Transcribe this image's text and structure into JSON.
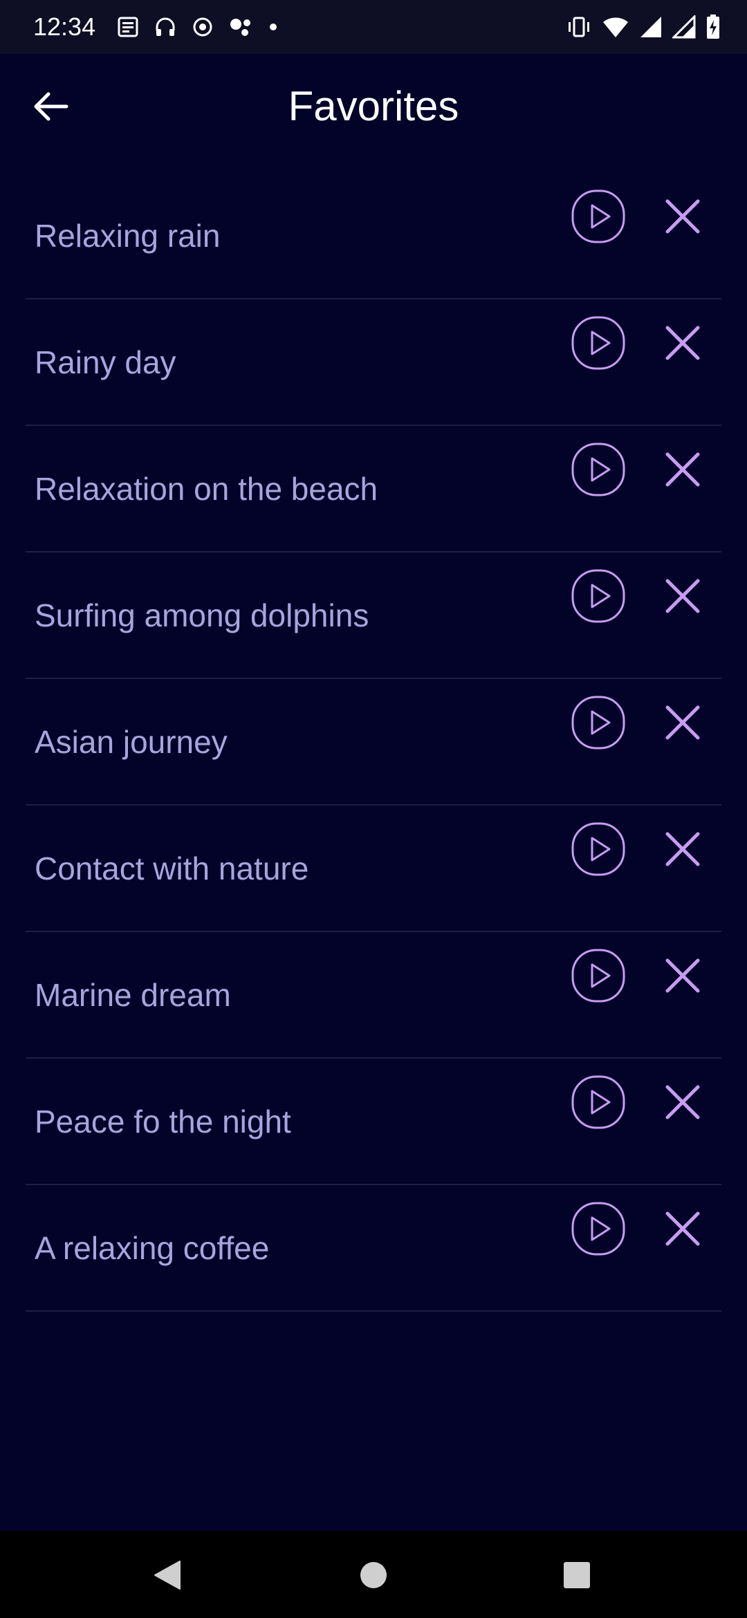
{
  "status_bar": {
    "time": "12:34",
    "left_icons": [
      "news-icon",
      "headphones-icon",
      "record-icon",
      "assistant-icon",
      "dot-icon"
    ],
    "right_icons": [
      "vibrate-icon",
      "wifi-icon",
      "signal-icon",
      "signal-icon",
      "battery-charging-icon"
    ]
  },
  "header": {
    "title": "Favorites",
    "back_icon": "arrow-left-icon"
  },
  "favorites": [
    {
      "title": "Relaxing rain"
    },
    {
      "title": "Rainy day"
    },
    {
      "title": "Relaxation on the beach"
    },
    {
      "title": "Surfing among dolphins"
    },
    {
      "title": "Asian journey"
    },
    {
      "title": "Contact with nature"
    },
    {
      "title": "Marine dream"
    },
    {
      "title": "Peace fo the night"
    },
    {
      "title": "A relaxing coffee"
    }
  ],
  "row_icons": {
    "play": "play-icon",
    "remove": "close-icon"
  },
  "colors": {
    "background": "#03032a",
    "status_bar": "#0e0e24",
    "item_text": "#a8a4dc",
    "accent": "#c89cf0",
    "divider": "#1d1d45"
  },
  "nav_bar": {
    "buttons": [
      "back-triangle-icon",
      "home-circle-icon",
      "recents-square-icon"
    ]
  }
}
